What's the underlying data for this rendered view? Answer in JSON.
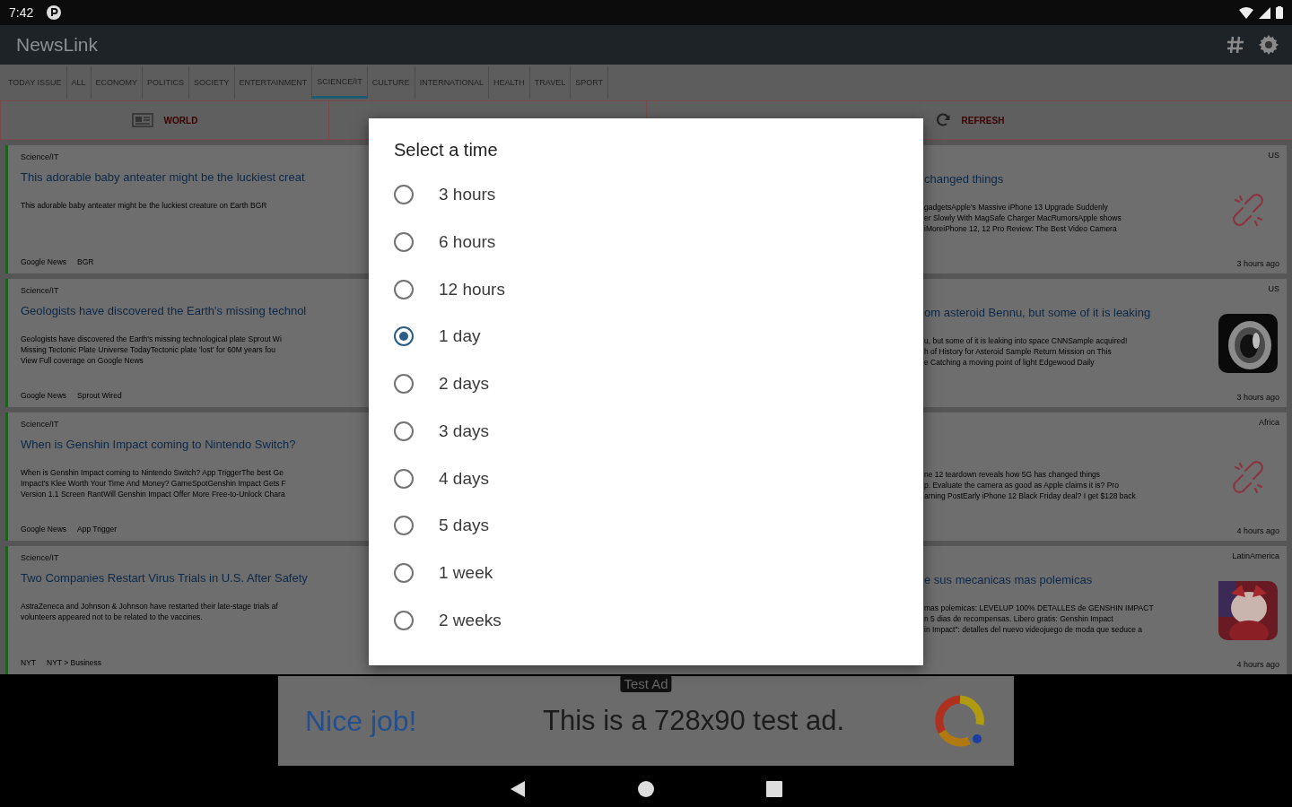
{
  "status_bar": {
    "time": "7:42"
  },
  "app_bar": {
    "title": "NewsLink"
  },
  "tabs": [
    {
      "label": "TODAY ISSUE",
      "selected": false
    },
    {
      "label": "ALL",
      "selected": false
    },
    {
      "label": "ECONOMY",
      "selected": false
    },
    {
      "label": "POLITICS",
      "selected": false
    },
    {
      "label": "SOCIETY",
      "selected": false
    },
    {
      "label": "ENTERTAINMENT",
      "selected": false
    },
    {
      "label": "SCIENCE/IT",
      "selected": true
    },
    {
      "label": "CULTURE",
      "selected": false
    },
    {
      "label": "INTERNATIONAL",
      "selected": false
    },
    {
      "label": "HEALTH",
      "selected": false
    },
    {
      "label": "TRAVEL",
      "selected": false
    },
    {
      "label": "SPORT",
      "selected": false
    }
  ],
  "actions": [
    {
      "kind": "world",
      "label": "WORLD"
    },
    {
      "kind": "refresh",
      "label": "REFRESH"
    }
  ],
  "articles": [
    {
      "category": "Science/IT",
      "title_left": "This adorable baby anteater might be the luckiest creat",
      "snippet_left": [
        "This adorable baby anteater might be the luckiest creature on Earth  BGR"
      ],
      "source": [
        "Google News",
        "BGR"
      ],
      "region": "US",
      "title_right": "changed things",
      "snippet_right": [
        "gadgetsApple's Massive iPhone 13 Upgrade Suddenly",
        "er Slowly With MagSafe Charger  MacRumorsApple shows",
        "  iMoreiPhone 12, 12 Pro Review: The Best Video Camera"
      ],
      "time": "3 hours ago",
      "thumbnail": {
        "kind": "broken-link"
      }
    },
    {
      "category": "Science/IT",
      "title_left": "Geologists have discovered the Earth's missing technol",
      "snippet_left": [
        "Geologists have discovered the Earth's missing technological plate  Sprout Wi",
        "Missing Tectonic Plate  Universe TodayTectonic plate 'lost' for 60M years fou",
        "View Full coverage on Google News"
      ],
      "source": [
        "Google News",
        "Sprout Wired"
      ],
      "region": "US",
      "title_right": "om asteroid Bennu, but some of it is leaking",
      "snippet_right": [
        "u, but some of it is leaking into space  CNNSample acquired!",
        "h of History for Asteroid Sample Return Mission on This",
        "e  Catching a moving point of light  Edgewood Daily"
      ],
      "time": "3 hours ago",
      "thumbnail": {
        "kind": "picture"
      }
    },
    {
      "category": "Science/IT",
      "title_left": "When is Genshin Impact coming to Nintendo Switch?",
      "snippet_left": [
        "When is Genshin Impact coming to Nintendo Switch?  App TriggerThe best Ge",
        "Impact's Klee Worth Your Time And Money?  GameSpotGenshin Impact Gets F",
        "Version 1.1  Screen RantWill Genshin Impact Offer More Free-to-Unlock Chara"
      ],
      "source": [
        "Google News",
        "App Trigger"
      ],
      "region": "Africa",
      "snippet_right": [
        "ne 12 teardown reveals how 5G has changed things",
        "p. Evaluate the camera as good as Apple claims it is? Pro",
        "arning PostEarly iPhone 12 Black Friday deal? I get $128 back"
      ],
      "time": "4 hours ago",
      "thumbnail": {
        "kind": "broken-link"
      }
    },
    {
      "category": "Science/IT",
      "title_left": "Two Companies Restart Virus Trials in U.S. After Safety",
      "snippet_left": [
        "AstraZeneca and Johnson & Johnson have restarted their late-stage trials af",
        "volunteers appeared not to be related to the vaccines."
      ],
      "source": [
        "NYT",
        "NYT > Business"
      ],
      "region": "LatinAmerica",
      "title_right": "e sus mecanicas mas polemicas",
      "snippet_right": [
        "mas polemicas: LEVELUP 100% DETALLES de GENSHIN IMPACT",
        "n 5 dias de recompensas. Libero gratis: Genshin Impact",
        "in Impact\": detalles del nuevo videojuego de moda que seduce a"
      ],
      "time": "4 hours ago",
      "thumbnail": {
        "kind": "picture"
      }
    }
  ],
  "dialog": {
    "title": "Select a time",
    "options": [
      {
        "label": "3 hours",
        "selected": false
      },
      {
        "label": "6 hours",
        "selected": false
      },
      {
        "label": "12 hours",
        "selected": false
      },
      {
        "label": "1 day",
        "selected": true
      },
      {
        "label": "2 days",
        "selected": false
      },
      {
        "label": "3 days",
        "selected": false
      },
      {
        "label": "4 days",
        "selected": false
      },
      {
        "label": "5 days",
        "selected": false
      },
      {
        "label": "1 week",
        "selected": false
      },
      {
        "label": "2 weeks",
        "selected": false
      }
    ]
  },
  "ad": {
    "badge": "Test Ad",
    "headline": "Nice job!",
    "text": "This is a 728x90 test ad."
  }
}
